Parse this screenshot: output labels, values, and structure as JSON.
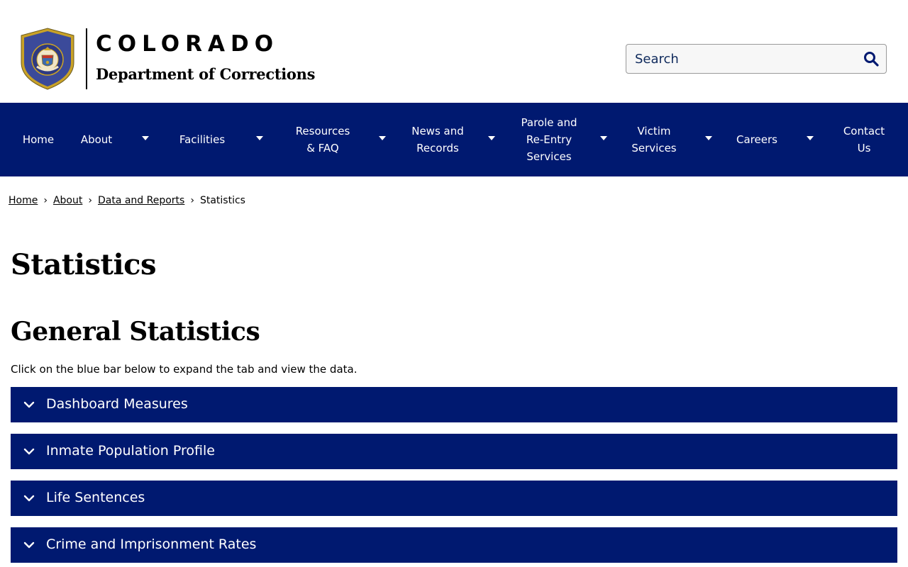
{
  "brand": {
    "title": "COLORADO",
    "subtitle": "Department of Corrections",
    "seal_text": "COLORADO DEPARTMENT OF CORRECTIONS"
  },
  "search": {
    "placeholder": "Search",
    "icon": "search-icon"
  },
  "nav": {
    "items": [
      {
        "label": "Home",
        "has_dropdown": false
      },
      {
        "label": "About",
        "has_dropdown": true
      },
      {
        "label": "Facilities",
        "has_dropdown": true
      },
      {
        "label": "Resources\n& FAQ",
        "has_dropdown": true
      },
      {
        "label": "News and\nRecords",
        "has_dropdown": true
      },
      {
        "label": "Parole and\nRe-Entry\nServices",
        "has_dropdown": true
      },
      {
        "label": "Victim\nServices",
        "has_dropdown": true
      },
      {
        "label": "Careers",
        "has_dropdown": true
      },
      {
        "label": "Contact\nUs",
        "has_dropdown": false
      }
    ]
  },
  "breadcrumb": {
    "items": [
      "Home",
      "About",
      "Data and Reports"
    ],
    "current": "Statistics",
    "separator": "›"
  },
  "page": {
    "title": "Statistics",
    "section_title": "General Statistics",
    "instructions": "Click on the blue bar below to expand the tab and view the data."
  },
  "accordion": {
    "items": [
      {
        "label": "Dashboard Measures"
      },
      {
        "label": "Inmate Population Profile"
      },
      {
        "label": "Life Sentences"
      },
      {
        "label": "Crime and Imprisonment Rates"
      }
    ]
  },
  "colors": {
    "nav_bg": "#001970",
    "accordion_bg": "#001970",
    "seal_blue": "#3b4a9a",
    "seal_gold": "#c9a227"
  }
}
